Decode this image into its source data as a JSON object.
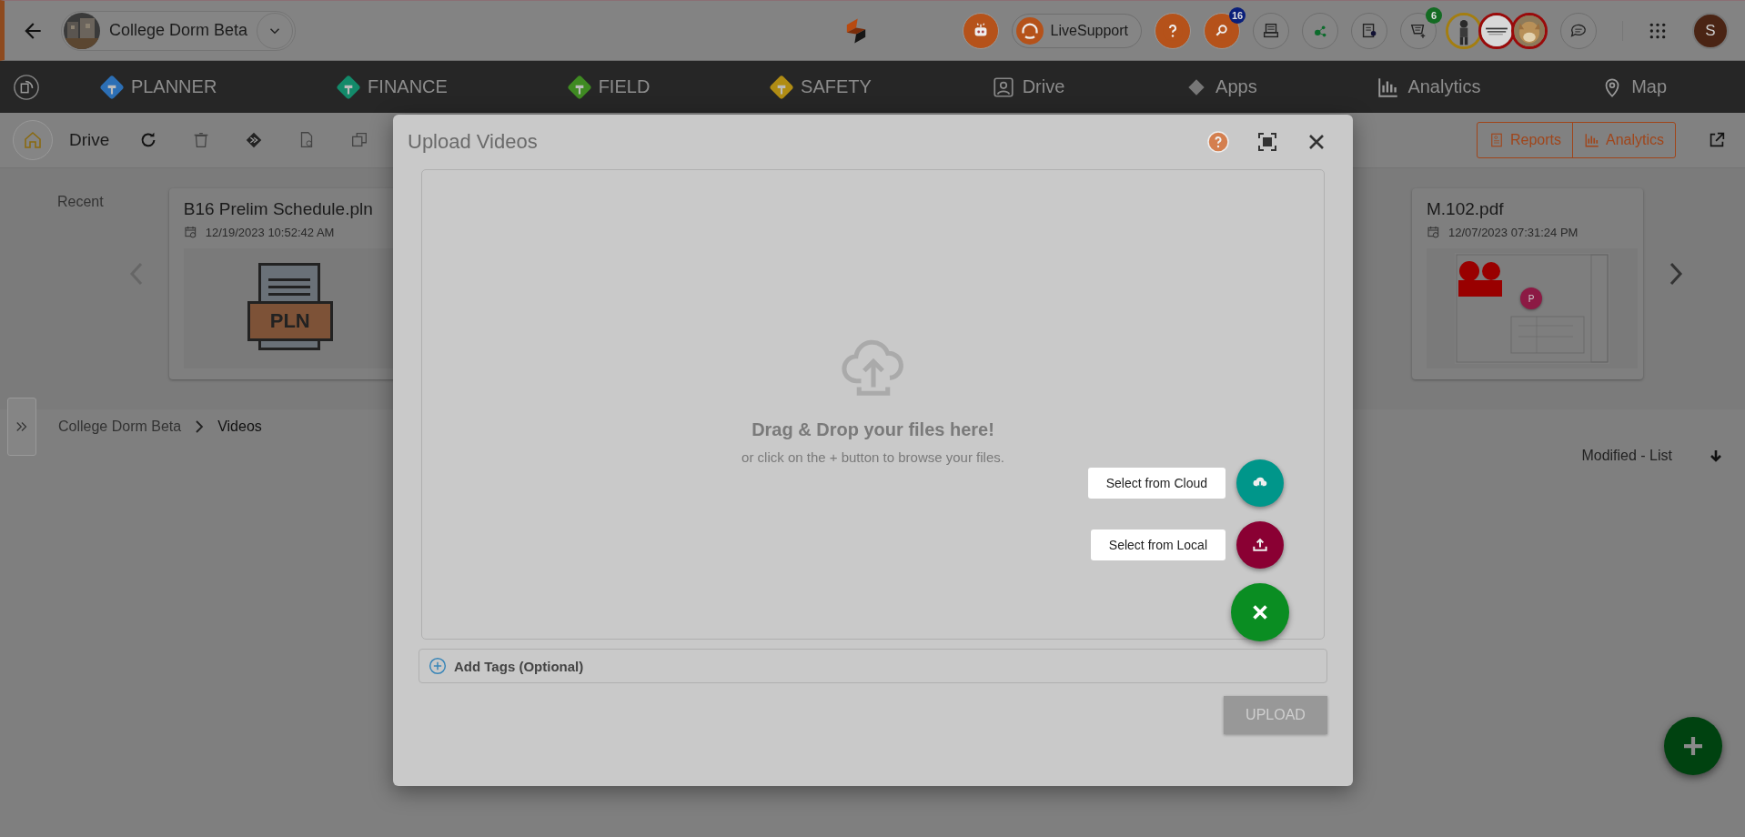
{
  "top_bar": {
    "project": {
      "name": "College Dorm Beta"
    },
    "live_support": "LiveSupport",
    "search_badge": "16",
    "cart_badge": "6",
    "user_initial": "S"
  },
  "modules": [
    {
      "label": "PLANNER",
      "kind": "tile",
      "color": "#2c6fb5"
    },
    {
      "label": "FINANCE",
      "kind": "tile",
      "color": "#138a6a"
    },
    {
      "label": "FIELD",
      "kind": "tile",
      "color": "#3f8a22"
    },
    {
      "label": "SAFETY",
      "kind": "tile",
      "color": "#b08c14"
    },
    {
      "label": "Drive",
      "kind": "drive"
    },
    {
      "label": "Apps",
      "kind": "apps"
    },
    {
      "label": "Analytics",
      "kind": "analytics"
    },
    {
      "label": "Map",
      "kind": "map"
    }
  ],
  "toolbar": {
    "title": "Drive",
    "reports": "Reports",
    "analytics": "Analytics"
  },
  "recent": {
    "label": "Recent",
    "cards": [
      {
        "name": "B16 Prelim Schedule.pln",
        "date": "12/19/2023 10:52:42 AM",
        "kind": "pln",
        "badge": "PLN"
      },
      {
        "name": "M.102.pdf",
        "date": "12/07/2023 07:31:24 PM",
        "kind": "pdf",
        "badge": "P"
      }
    ]
  },
  "breadcrumb": [
    "College Dorm Beta",
    "Videos"
  ],
  "sort": "Modified - List",
  "dialog": {
    "title": "Upload Videos",
    "drop_title": "Drag & Drop your files here!",
    "drop_hint": "or click on the + button to browse your files.",
    "actions": [
      {
        "label": "Select from Cloud",
        "kind": "cloud",
        "color": "#00968a"
      },
      {
        "label": "Select from Local",
        "kind": "local",
        "color": "#8a0033"
      }
    ],
    "tags_label": "Add Tags (Optional)",
    "upload": {
      "label": "UPLOAD",
      "disabled": true
    }
  }
}
